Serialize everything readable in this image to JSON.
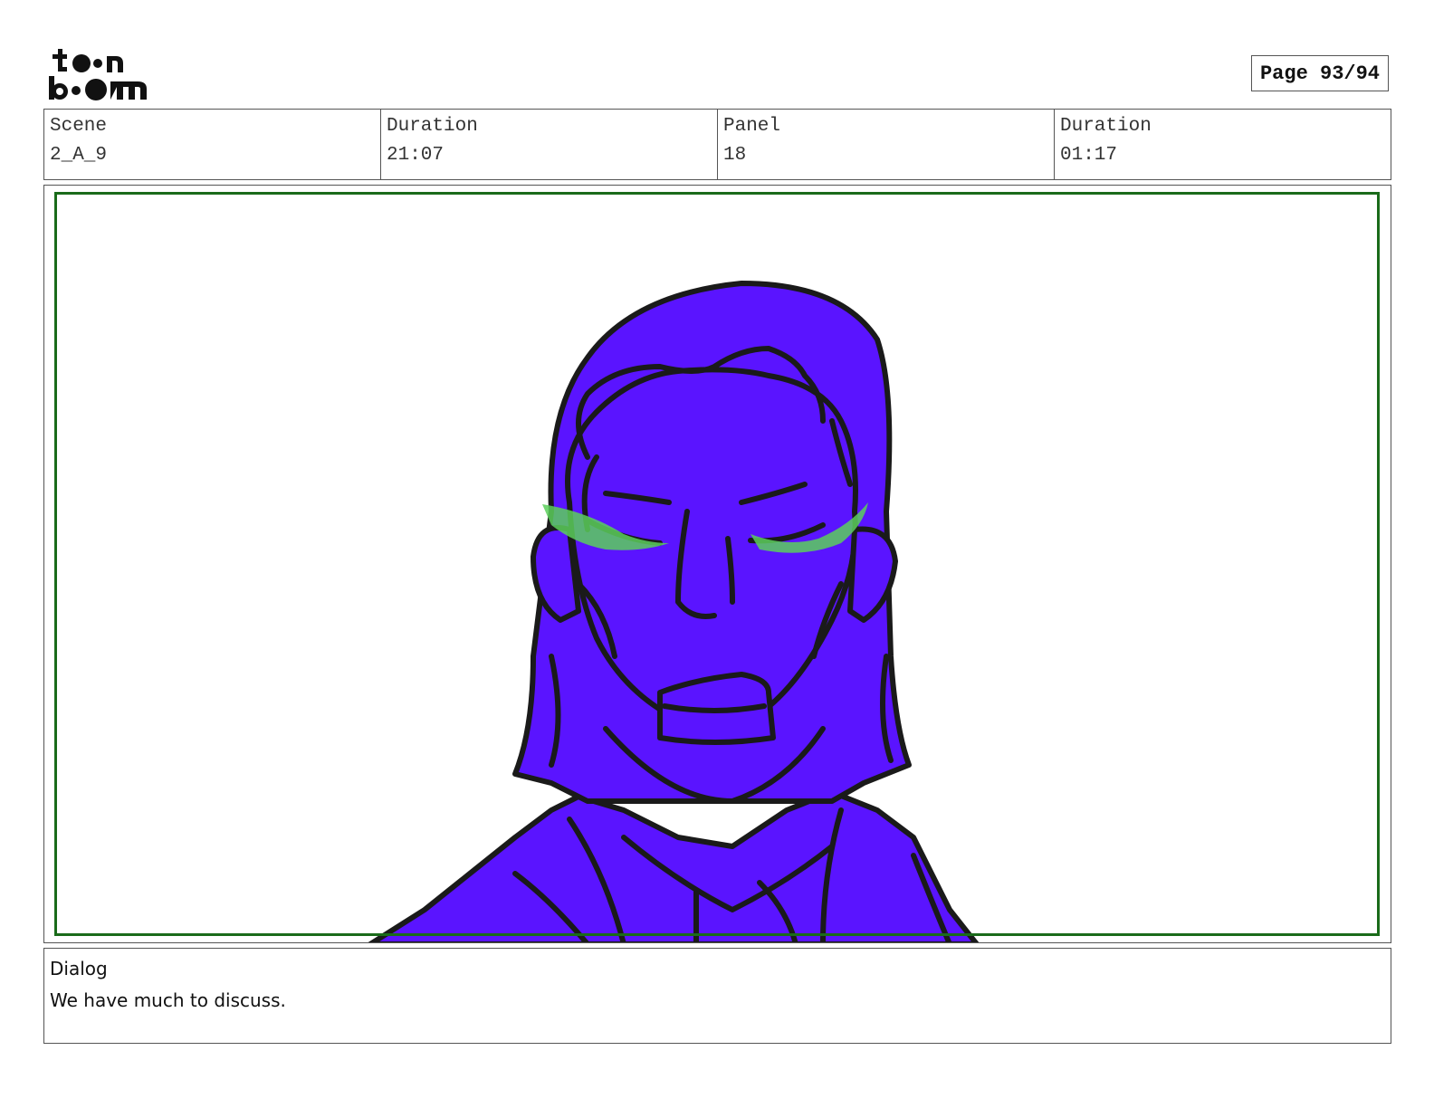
{
  "header": {
    "logo_name": "toon boom",
    "page_label": "Page 93/94"
  },
  "info": {
    "scene_label": "Scene",
    "scene_value": "2_A_9",
    "duration_label": "Duration",
    "duration_value": "21:07",
    "panel_label": "Panel",
    "panel_value": "18",
    "panel_duration_label": "Duration",
    "panel_duration_value": "01:17"
  },
  "panel": {
    "fill_color": "#5a14ff",
    "glow_color": "#5ccf5c",
    "frame_color": "#1a6b1a"
  },
  "dialog": {
    "label": "Dialog",
    "text": "We have much to discuss."
  }
}
